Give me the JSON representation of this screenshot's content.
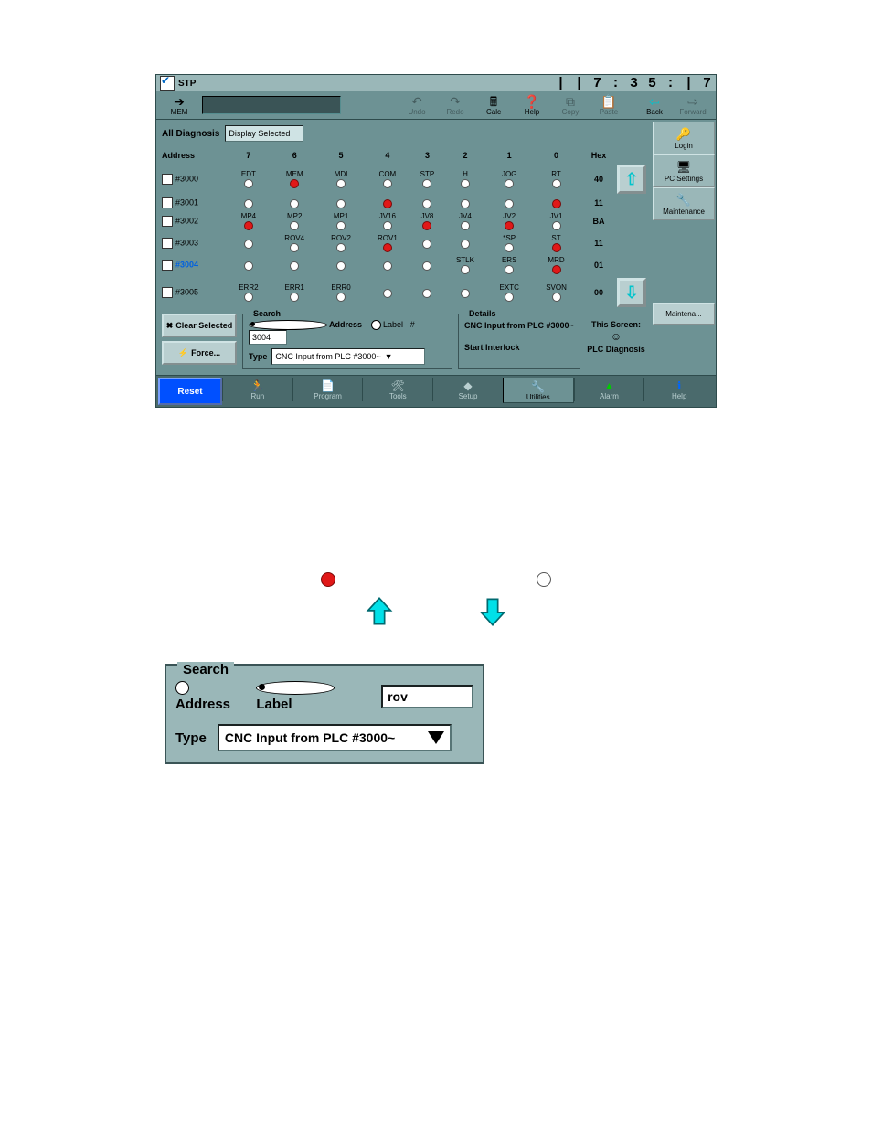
{
  "titlebar": {
    "mode": "STP",
    "clock": "| | 7 : 3 5 : | 7"
  },
  "toolbar": {
    "mem": "MEM",
    "undo": "Undo",
    "redo": "Redo",
    "calc": "Calc",
    "help": "Help",
    "copy": "Copy",
    "paste": "Paste",
    "back": "Back",
    "forward": "Forward"
  },
  "side": {
    "login": "Login",
    "pcsettings": "PC Settings",
    "maintenance": "Maintenance",
    "maintena": "Maintena..."
  },
  "filter": {
    "label": "All Diagnosis",
    "sel": "Display Selected"
  },
  "headers": [
    "Address",
    "7",
    "6",
    "5",
    "4",
    "3",
    "2",
    "1",
    "0",
    "Hex"
  ],
  "rows": [
    {
      "addr": "#3000",
      "hex": "40",
      "bits": [
        {
          "lbl": "EDT",
          "on": false
        },
        {
          "lbl": "MEM",
          "on": true
        },
        {
          "lbl": "MDI",
          "on": false
        },
        {
          "lbl": "COM",
          "on": false
        },
        {
          "lbl": "STP",
          "on": false
        },
        {
          "lbl": "H",
          "on": false
        },
        {
          "lbl": "JOG",
          "on": false
        },
        {
          "lbl": "RT",
          "on": false
        }
      ]
    },
    {
      "addr": "#3001",
      "hex": "11",
      "bits": [
        {
          "lbl": "",
          "on": false
        },
        {
          "lbl": "",
          "on": false
        },
        {
          "lbl": "",
          "on": false
        },
        {
          "lbl": "",
          "on": true
        },
        {
          "lbl": "",
          "on": false
        },
        {
          "lbl": "",
          "on": false
        },
        {
          "lbl": "",
          "on": false
        },
        {
          "lbl": "",
          "on": true
        }
      ]
    },
    {
      "addr": "#3002",
      "hex": "BA",
      "bits": [
        {
          "lbl": "MP4",
          "on": true
        },
        {
          "lbl": "MP2",
          "on": false
        },
        {
          "lbl": "MP1",
          "on": false
        },
        {
          "lbl": "JV16",
          "on": false
        },
        {
          "lbl": "JV8",
          "on": true
        },
        {
          "lbl": "JV4",
          "on": false
        },
        {
          "lbl": "JV2",
          "on": true
        },
        {
          "lbl": "JV1",
          "on": false
        }
      ]
    },
    {
      "addr": "#3003",
      "hex": "11",
      "bits": [
        {
          "lbl": "",
          "on": false
        },
        {
          "lbl": "ROV4",
          "on": false
        },
        {
          "lbl": "ROV2",
          "on": false
        },
        {
          "lbl": "ROV1",
          "on": true
        },
        {
          "lbl": "",
          "on": false
        },
        {
          "lbl": "",
          "on": false
        },
        {
          "lbl": "*SP",
          "on": false
        },
        {
          "lbl": "ST",
          "on": true
        }
      ]
    },
    {
      "addr": "#3004",
      "hex": "01",
      "sel": true,
      "bits": [
        {
          "lbl": "",
          "on": false
        },
        {
          "lbl": "",
          "on": false
        },
        {
          "lbl": "",
          "on": false
        },
        {
          "lbl": "",
          "on": false
        },
        {
          "lbl": "",
          "on": false
        },
        {
          "lbl": "STLK",
          "on": false
        },
        {
          "lbl": "ERS",
          "on": false
        },
        {
          "lbl": "MRD",
          "on": true
        }
      ]
    },
    {
      "addr": "#3005",
      "hex": "00",
      "bits": [
        {
          "lbl": "ERR2",
          "on": false
        },
        {
          "lbl": "ERR1",
          "on": false
        },
        {
          "lbl": "ERR0",
          "on": false
        },
        {
          "lbl": "",
          "on": false
        },
        {
          "lbl": "",
          "on": false
        },
        {
          "lbl": "",
          "on": false
        },
        {
          "lbl": "EXTC",
          "on": false
        },
        {
          "lbl": "SVON",
          "on": false
        }
      ]
    }
  ],
  "btns": {
    "clear": "Clear Selected",
    "force": "Force..."
  },
  "search": {
    "legend": "Search",
    "address": "Address",
    "label": "Label",
    "hash": "#",
    "hashval": "3004",
    "type": "Type",
    "typeval": "CNC Input from PLC #3000~"
  },
  "details": {
    "legend": "Details",
    "line1": "CNC Input from PLC #3000~",
    "line2": "Start Interlock"
  },
  "this": {
    "title": "This Screen:",
    "sub": "PLC Diagnosis"
  },
  "nav": {
    "reset": "Reset",
    "run": "Run",
    "program": "Program",
    "tools": "Tools",
    "setup": "Setup",
    "utilities": "Utilities",
    "alarm": "Alarm",
    "help": "Help"
  },
  "big": {
    "legend": "Search",
    "address": "Address",
    "label": "Label",
    "val": "rov",
    "type": "Type",
    "typeval": "CNC Input from PLC #3000~"
  }
}
